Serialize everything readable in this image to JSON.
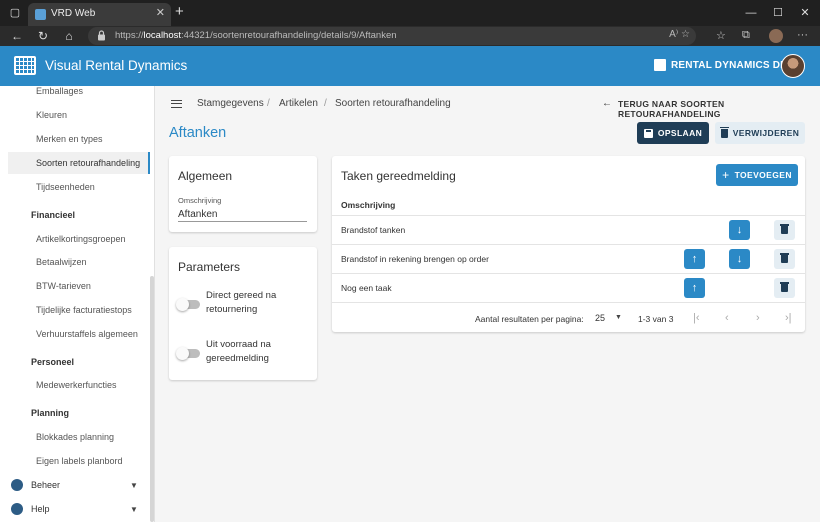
{
  "browser": {
    "tab_title": "VRD Web",
    "tab_close": "✕",
    "new_tab": "+",
    "url_host": "localhost",
    "url_prefix": "https://",
    "url_rest": ":44321/soortenretourafhandeling/details/9/Aftanken",
    "window_controls": [
      "—",
      "☐",
      "✕"
    ]
  },
  "app": {
    "title": "Visual Rental Dynamics",
    "environment": "RENTAL DYNAMICS DEV"
  },
  "sidebar": {
    "items_top": [
      "Emballages",
      "Kleuren",
      "Merken en types",
      "Soorten retourafhandeling",
      "Tijdseenheden"
    ],
    "active_item": "Soorten retourafhandeling",
    "groups": [
      {
        "heading": "Financieel",
        "items": [
          "Artikelkortingsgroepen",
          "Betaalwijzen",
          "BTW-tarieven",
          "Tijdelijke facturatiestops",
          "Verhuurstaffels algemeen"
        ]
      },
      {
        "heading": "Personeel",
        "items": [
          "Medewerkerfuncties"
        ]
      },
      {
        "heading": "Planning",
        "items": [
          "Blokkades planning",
          "Eigen labels planbord"
        ]
      }
    ],
    "bottom": [
      {
        "label": "Beheer",
        "icon": "gear-icon"
      },
      {
        "label": "Help",
        "icon": "lifebuoy-icon"
      }
    ]
  },
  "breadcrumb": [
    "Stamgegevens",
    "Artikelen",
    "Soorten retourafhandeling"
  ],
  "back_link": "TERUG NAAR SOORTEN RETOURAFHANDELING",
  "page_title": "Aftanken",
  "actions": {
    "save": "OPSLAAN",
    "delete": "VERWIJDEREN"
  },
  "general": {
    "title": "Algemeen",
    "field_label": "Omschrijving",
    "field_value": "Aftanken"
  },
  "parameters": {
    "title": "Parameters",
    "toggles": [
      {
        "label": "Direct gereed na retournering",
        "on": false
      },
      {
        "label": "Uit voorraad na gereedmelding",
        "on": false
      }
    ]
  },
  "tasks": {
    "title": "Taken gereedmelding",
    "add_label": "TOEVOEGEN",
    "column": "Omschrijving",
    "rows": [
      {
        "text": "Brandstof tanken",
        "up": false,
        "down": true
      },
      {
        "text": "Brandstof in rekening brengen op order",
        "up": true,
        "down": true
      },
      {
        "text": "Nog een taak",
        "up": true,
        "down": false
      }
    ],
    "pager": {
      "per_page_label": "Aantal resultaten per pagina:",
      "per_page_value": "25",
      "range": "1-3 van 3"
    }
  },
  "colors": {
    "primary": "#2b89c6",
    "dark": "#1f3d56"
  }
}
